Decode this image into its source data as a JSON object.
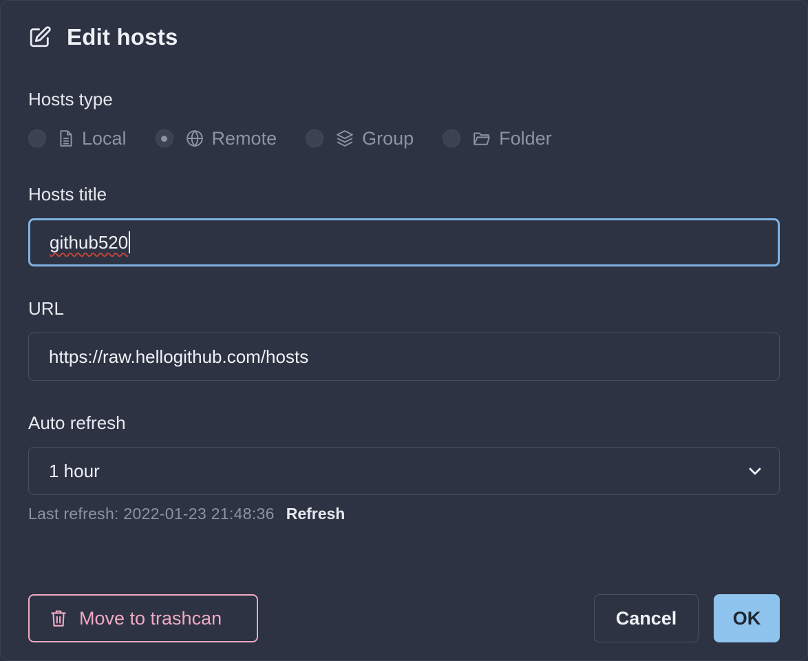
{
  "dialog": {
    "title": "Edit hosts",
    "title_icon": "edit-icon"
  },
  "hosts_type": {
    "label": "Hosts type",
    "selected": "Remote",
    "options": [
      {
        "label": "Local",
        "icon": "file-icon"
      },
      {
        "label": "Remote",
        "icon": "globe-icon"
      },
      {
        "label": "Group",
        "icon": "layers-icon"
      },
      {
        "label": "Folder",
        "icon": "folder-icon"
      }
    ]
  },
  "hosts_title": {
    "label": "Hosts title",
    "value": "github520"
  },
  "url": {
    "label": "URL",
    "value": "https://raw.hellogithub.com/hosts"
  },
  "auto_refresh": {
    "label": "Auto refresh",
    "value": "1 hour",
    "last_refresh": "Last refresh: 2022-01-23 21:48:36",
    "refresh_label": "Refresh"
  },
  "actions": {
    "trash_label": "Move to trashcan",
    "trash_icon": "trash-icon",
    "cancel_label": "Cancel",
    "ok_label": "OK"
  },
  "colors": {
    "background": "#2d3342",
    "focus_border": "#7fb3e4",
    "primary_button": "#8fc4ee",
    "danger": "#f0a9c4"
  }
}
